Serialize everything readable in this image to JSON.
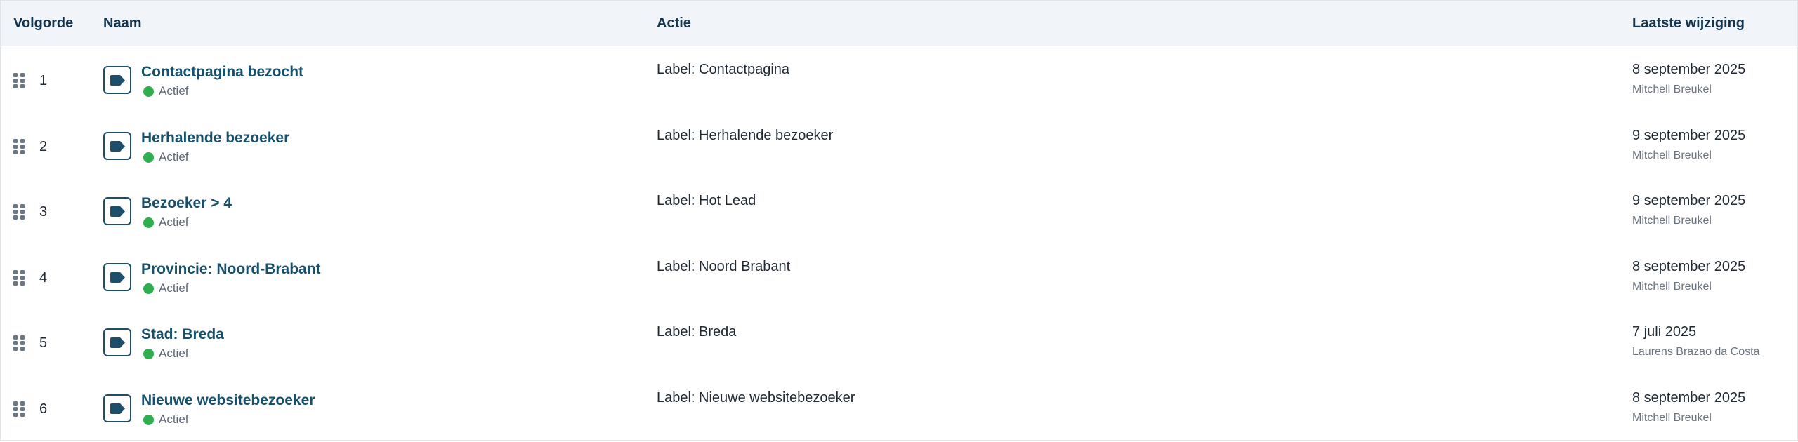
{
  "header": {
    "order": "Volgorde",
    "name": "Naam",
    "action": "Actie",
    "modified": "Laatste wijziging"
  },
  "colors": {
    "header_bg": "#f1f5f9",
    "name_link": "#16506c",
    "status_active": "#2fae4f",
    "icon_border": "#1d4f6b"
  },
  "rows": [
    {
      "order": "1",
      "name": "Contactpagina bezocht",
      "icon": "tag-icon",
      "status": "Actief",
      "action": "Label: Contactpagina",
      "date": "8 september 2025",
      "user": "Mitchell Breukel"
    },
    {
      "order": "2",
      "name": "Herhalende bezoeker",
      "icon": "tag-icon",
      "status": "Actief",
      "action": "Label: Herhalende bezoeker",
      "date": "9 september 2025",
      "user": "Mitchell Breukel"
    },
    {
      "order": "3",
      "name": "Bezoeker > 4",
      "icon": "tag-icon",
      "status": "Actief",
      "action": "Label: Hot Lead",
      "date": "9 september 2025",
      "user": "Mitchell Breukel"
    },
    {
      "order": "4",
      "name": "Provincie: Noord-Brabant",
      "icon": "tag-icon",
      "status": "Actief",
      "action": "Label: Noord Brabant",
      "date": "8 september 2025",
      "user": "Mitchell Breukel"
    },
    {
      "order": "5",
      "name": "Stad: Breda",
      "icon": "tag-icon",
      "status": "Actief",
      "action": "Label: Breda",
      "date": "7 juli 2025",
      "user": "Laurens Brazao da Costa"
    },
    {
      "order": "6",
      "name": "Nieuwe websitebezoeker",
      "icon": "tag-icon",
      "status": "Actief",
      "action": "Label: Nieuwe websitebezoeker",
      "date": "8 september 2025",
      "user": "Mitchell Breukel"
    }
  ]
}
